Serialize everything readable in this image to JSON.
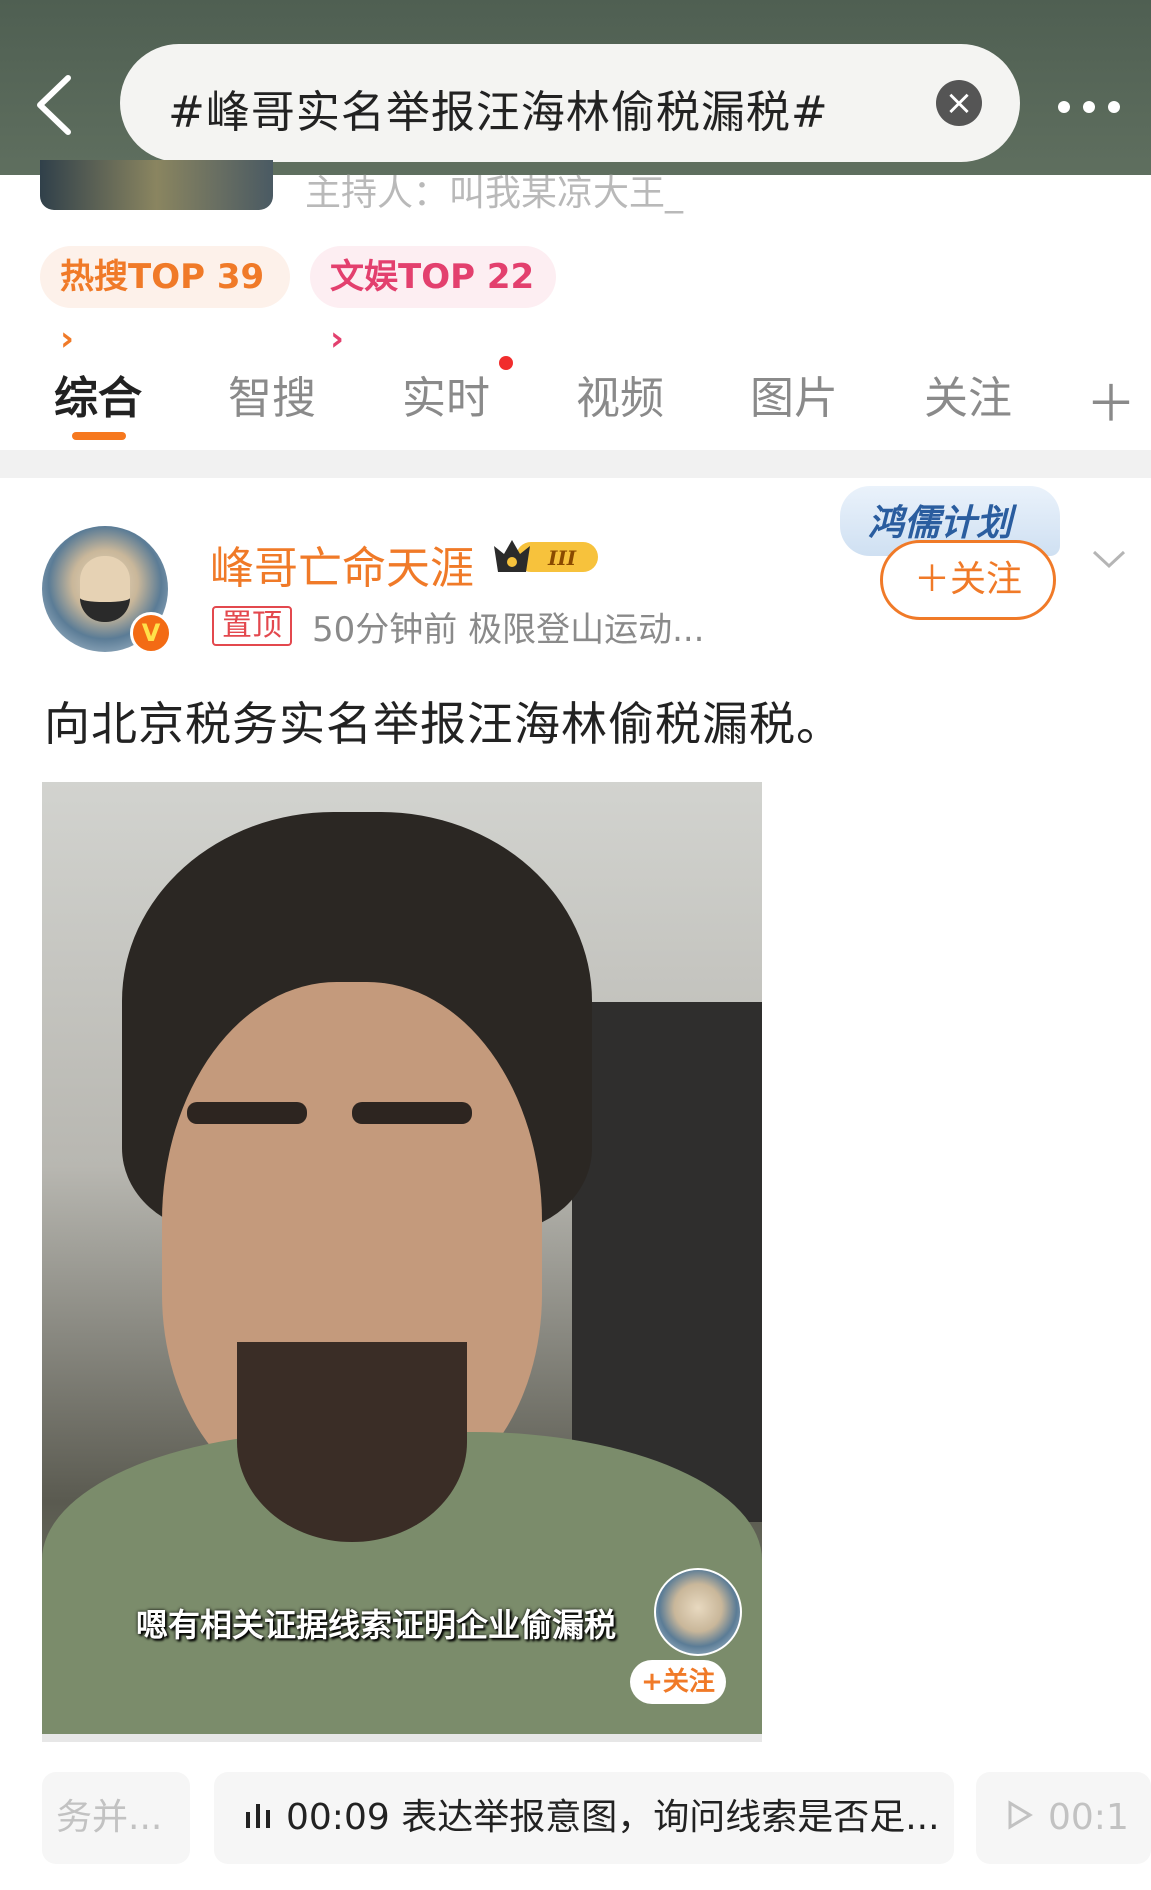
{
  "search": {
    "query": "#峰哥实名举报汪海林偷税漏税#"
  },
  "topic": {
    "host": "主持人：叫我某凉大王_"
  },
  "badges": {
    "hot": "热搜TOP 39",
    "ent": "文娱TOP 22"
  },
  "tabs": [
    "综合",
    "智搜",
    "实时",
    "视频",
    "图片",
    "关注"
  ],
  "post": {
    "username": "峰哥亡命天涯",
    "pin_label": "置顶",
    "meta": "50分钟前  极限登山运动...",
    "plan_label": "鸿儒计划",
    "follow_label": "＋关注",
    "text": "向北京税务实名举报汪海林偷税漏税。",
    "video": {
      "subtitle": "嗯有相关证据线索证明企业偷漏税",
      "mini_follow": "+关注"
    }
  },
  "chapters": {
    "left": "务并...",
    "current": "00:09 表达举报意图，询问线索是否足...",
    "right": "00:1"
  },
  "colors": {
    "accent": "#f07a28",
    "hot_pink": "#e3406e",
    "dot_red": "#f12d2d"
  }
}
